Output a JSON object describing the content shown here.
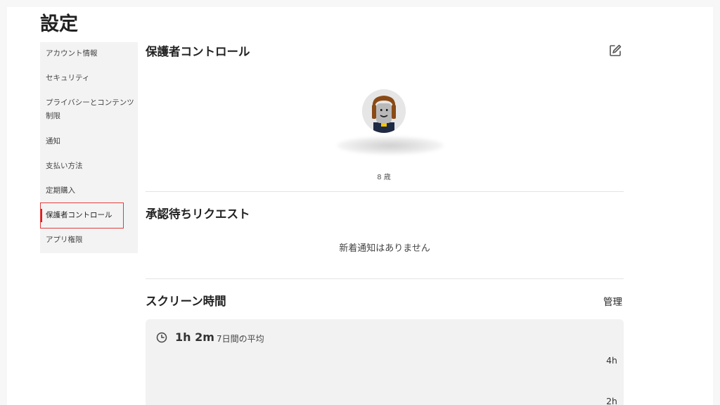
{
  "page": {
    "title": "設定"
  },
  "sidebar": {
    "items": [
      {
        "label": "アカウント情報"
      },
      {
        "label": "セキュリティ"
      },
      {
        "label": "プライバシーとコンテンツ"
      },
      {
        "label": "制限"
      },
      {
        "label": "通知"
      },
      {
        "label": "支払い方法"
      },
      {
        "label": "定期購入"
      },
      {
        "label": "保護者コントロール",
        "active": true
      },
      {
        "label": "アプリ権限"
      }
    ]
  },
  "parental": {
    "title": "保護者コントロール",
    "edit_icon": "pencil-square-icon",
    "avatar_icon": "roblox-avatar",
    "age": "8 歳"
  },
  "requests": {
    "title": "承認待ちリクエスト",
    "empty_message": "新着通知はありません"
  },
  "screen_time": {
    "title": "スクリーン時間",
    "manage_label": "管理",
    "average_value": "1h 2m",
    "average_label": "7日間の平均",
    "clock_icon": "clock-icon",
    "axis_ticks": [
      "4h",
      "2h"
    ]
  },
  "colors": {
    "accent": "#e21b1b",
    "card_bg": "#f2f2f2",
    "sidebar_bg": "#f3f3f3"
  }
}
